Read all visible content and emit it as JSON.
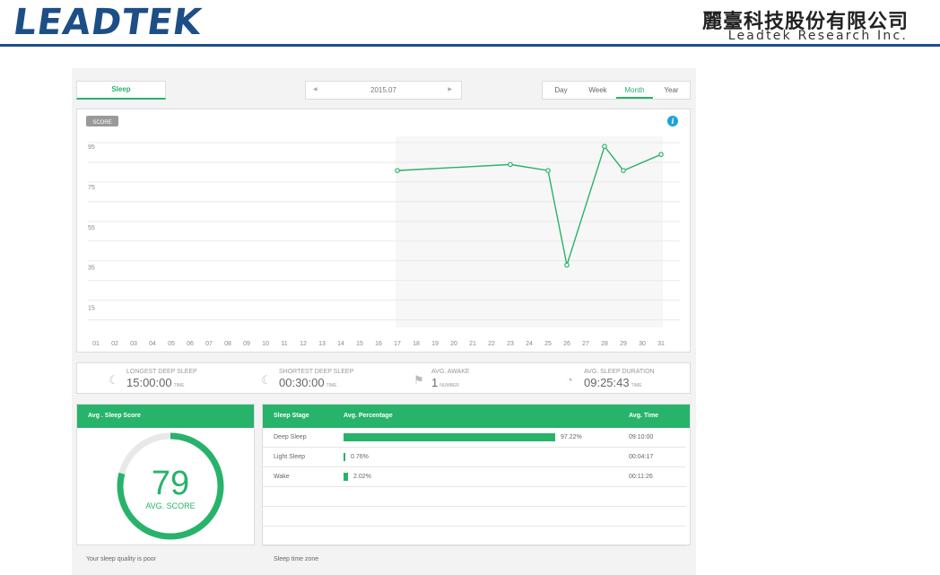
{
  "header": {
    "logo": "LEADTEK",
    "brand_cn": "麗臺科技股份有限公司",
    "brand_en": "Leadtek Research Inc."
  },
  "tabs": {
    "sleep": "Sleep"
  },
  "date_nav": {
    "current": "2015.07",
    "prev_icon": "chevron-left-icon",
    "next_icon": "chevron-right-icon"
  },
  "periods": [
    "Day",
    "Week",
    "Month",
    "Year"
  ],
  "active_period": "Month",
  "chart_data": {
    "type": "line",
    "badge": "SCORE",
    "info_icon": "info-icon",
    "categories": [
      "01",
      "02",
      "03",
      "04",
      "05",
      "06",
      "07",
      "08",
      "09",
      "10",
      "11",
      "12",
      "13",
      "14",
      "15",
      "16",
      "17",
      "18",
      "19",
      "20",
      "21",
      "22",
      "23",
      "24",
      "25",
      "26",
      "27",
      "28",
      "29",
      "30",
      "31"
    ],
    "y_ticks": [
      "95",
      "75",
      "55",
      "35",
      "15"
    ],
    "ylim": [
      5,
      100
    ],
    "series": [
      {
        "color": "#27b36a",
        "points": [
          [
            17,
            83
          ],
          [
            23,
            86
          ],
          [
            25,
            83
          ],
          [
            26,
            36
          ],
          [
            28,
            95
          ],
          [
            29,
            83
          ],
          [
            31,
            91
          ]
        ]
      }
    ],
    "highlight_from": 17,
    "grid": true
  },
  "stats": [
    {
      "icon": "moon-icon",
      "label": "LONGEST DEEP SLEEP",
      "value": "15:00:00",
      "unit": "TIME"
    },
    {
      "icon": "moon-icon",
      "label": "SHORTEST DEEP SLEEP",
      "value": "00:30:00",
      "unit": "TIME"
    },
    {
      "icon": "flag-icon",
      "label": "AVG. AWAKE",
      "value": "1",
      "unit": "NUMBER"
    },
    {
      "icon": "gauge-icon",
      "label": "AVG. SLEEP DURATION",
      "value": "09:25:43",
      "unit": "TIME"
    }
  ],
  "score_panel": {
    "title": "Avg . Sleep Score",
    "score": "79",
    "score_label": "AVG. SCORE",
    "score_fraction": 0.79
  },
  "stage_table": {
    "headers": [
      "Sleep Stage",
      "Avg. Percentage",
      "Avg. Time"
    ],
    "rows": [
      {
        "stage": "Deep Sleep",
        "percent": "97.22%",
        "fraction": 0.9722,
        "time": "09:10:00"
      },
      {
        "stage": "Light Sleep",
        "percent": "0.76%",
        "fraction": 0.0076,
        "time": "00:04:17"
      },
      {
        "stage": "Wake",
        "percent": "2.02%",
        "fraction": 0.0202,
        "time": "00:11:26"
      }
    ]
  },
  "footer": {
    "quality": "Your sleep quality is poor",
    "timezone": "Sleep time zone"
  },
  "colors": {
    "accent": "#27b36a",
    "brand": "#1d4f86"
  }
}
